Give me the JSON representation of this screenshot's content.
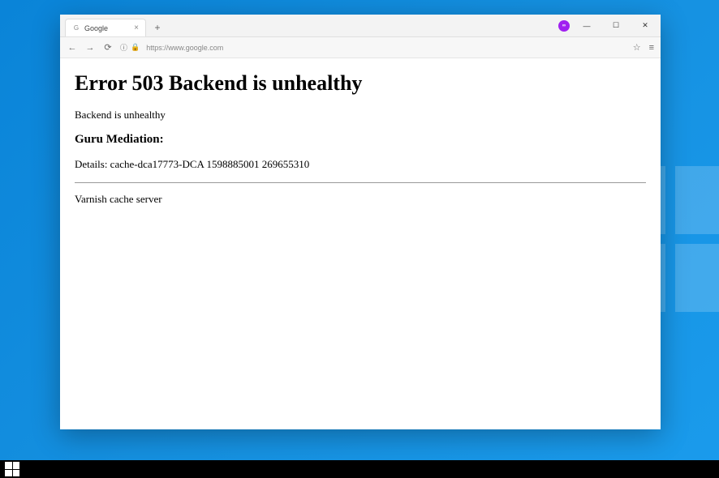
{
  "browser": {
    "tab": {
      "title": "Google",
      "favicon": "G"
    },
    "new_tab_label": "+",
    "tab_close": "×",
    "extension_label": "∞",
    "window": {
      "minimize": "—",
      "maximize": "☐",
      "close": "✕"
    },
    "nav": {
      "back": "←",
      "forward": "→",
      "reload": "⟳"
    },
    "address": {
      "info_icon": "ⓘ",
      "lock_icon": "🔒",
      "url": "https://www.google.com",
      "star_icon": "☆",
      "menu_icon": "≡"
    }
  },
  "page": {
    "heading": "Error 503 Backend is unhealthy",
    "message": "Backend is unhealthy",
    "subheading": "Guru Mediation:",
    "details": "Details: cache-dca17773-DCA 1598885001 269655310",
    "footer": "Varnish cache server"
  }
}
